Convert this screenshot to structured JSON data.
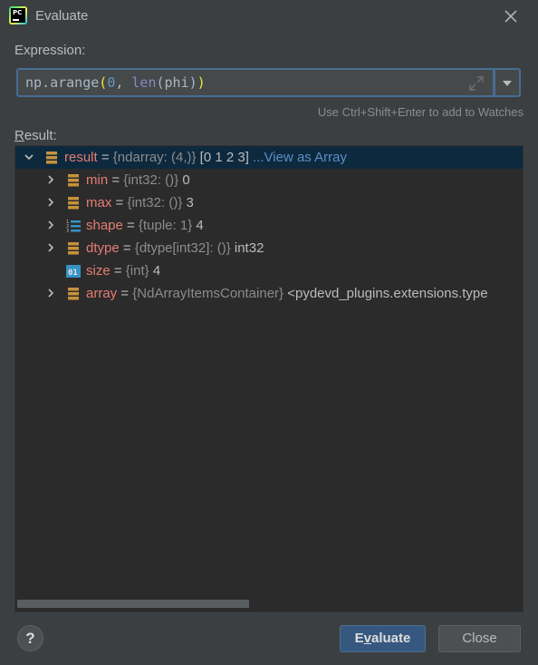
{
  "window": {
    "title": "Evaluate",
    "app_icon_text": "PC"
  },
  "expression": {
    "label": "Expression:",
    "tokens": [
      {
        "text": "np.arange",
        "kind": "plain"
      },
      {
        "text": "(",
        "kind": "paren"
      },
      {
        "text": "0",
        "kind": "num"
      },
      {
        "text": ", ",
        "kind": "plain"
      },
      {
        "text": "len",
        "kind": "bi"
      },
      {
        "text": "(phi)",
        "kind": "plain"
      },
      {
        "text": ")",
        "kind": "paren"
      }
    ],
    "hint": "Use Ctrl+Shift+Enter to add to Watches"
  },
  "result": {
    "label_first": "R",
    "label_rest": "esult:",
    "root": {
      "name": "result",
      "eq": " = ",
      "type": "{ndarray: (4,)}",
      "value": " [0 1 2 3]",
      "link": " ...View as Array",
      "icon": "field-icon",
      "expanded": true
    },
    "children": [
      {
        "name": "min",
        "eq": " = ",
        "type": "{int32: ()}",
        "value": " 0",
        "icon": "field-icon",
        "expandable": true
      },
      {
        "name": "max",
        "eq": " = ",
        "type": "{int32: ()}",
        "value": " 3",
        "icon": "field-icon",
        "expandable": true
      },
      {
        "name": "shape",
        "eq": " = ",
        "type": "{tuple: 1}",
        "value": " 4",
        "icon": "list-icon",
        "expandable": true
      },
      {
        "name": "dtype",
        "eq": " = ",
        "type": "{dtype[int32]: ()}",
        "value": " int32",
        "icon": "field-icon",
        "expandable": true
      },
      {
        "name": "size",
        "eq": " = ",
        "type": "{int}",
        "value": " 4",
        "icon": "int-icon",
        "expandable": false
      },
      {
        "name": "array",
        "eq": " = ",
        "type": "{NdArrayItemsContainer}",
        "value": " <pydevd_plugins.extensions.type",
        "icon": "field-icon",
        "expandable": true
      }
    ]
  },
  "buttons": {
    "help": "?",
    "evaluate_first": "E",
    "evaluate_mnemonic": "v",
    "evaluate_rest": "aluate",
    "close": "Close"
  },
  "colors": {
    "background": "#3c3f41",
    "panel": "#2b2b2b",
    "selection": "#0d293e",
    "focus_border": "#466d94",
    "var_name": "#e67c73",
    "link": "#5c8ec7",
    "primary_button": "#365880"
  }
}
